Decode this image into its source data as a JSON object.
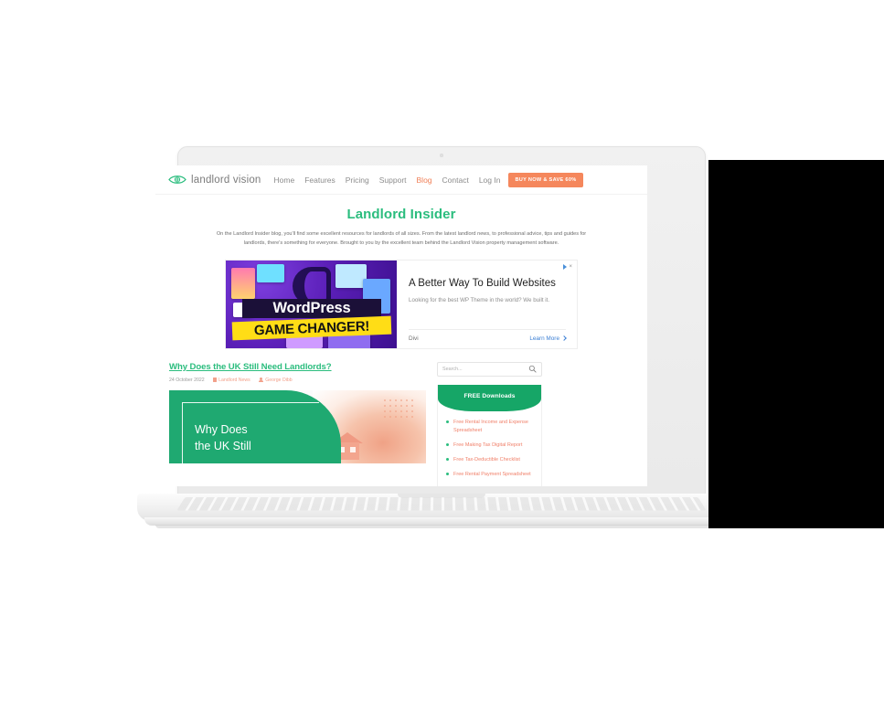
{
  "site": {
    "brand": {
      "name": "landlord vision",
      "logo_color": "#2bbd7e"
    },
    "nav": [
      {
        "label": "Home",
        "active": false
      },
      {
        "label": "Features",
        "active": false
      },
      {
        "label": "Pricing",
        "active": false
      },
      {
        "label": "Support",
        "active": false
      },
      {
        "label": "Blog",
        "active": true
      },
      {
        "label": "Contact",
        "active": false
      },
      {
        "label": "Log In",
        "active": false
      }
    ],
    "cta": {
      "label": "BUY NOW & SAVE 60%",
      "color": "#f5875c"
    },
    "hero": {
      "title": "Landlord Insider",
      "description": "On the Landlord Insider blog, you'll find some excellent resources for landlords of all sizes. From the latest landlord news, to professional advice, tips and guides for landlords, there's something for everyone. Brought to you by the excellent team behind the Landlord Vision property management software.",
      "title_color": "#2bbd7e"
    },
    "ad": {
      "creative_line1": "WordPress",
      "creative_line2": "GAME CHANGER!",
      "logo_letter": "D",
      "headline": "A Better Way To Build Websites",
      "subtext": "Looking for the best WP Theme in the world? We built it.",
      "advertiser": "Divi",
      "cta": "Learn More",
      "close_label": "×"
    },
    "post": {
      "title": "Why Does the UK Still Need Landlords?",
      "date": "24 October 2022",
      "category": "Landlord News",
      "author": "George Dibb",
      "image_line1": "Why Does",
      "image_line2": "the UK Still"
    },
    "sidebar": {
      "search_placeholder": "Search...",
      "search_value": "",
      "downloads_title": "FREE Downloads",
      "downloads": [
        "Free Rental Income and Expense Spreadsheet",
        "Free Making Tax Digital Report",
        "Free Tax-Deductible Checklist",
        "Free Rental Payment Spreadsheet"
      ]
    }
  }
}
